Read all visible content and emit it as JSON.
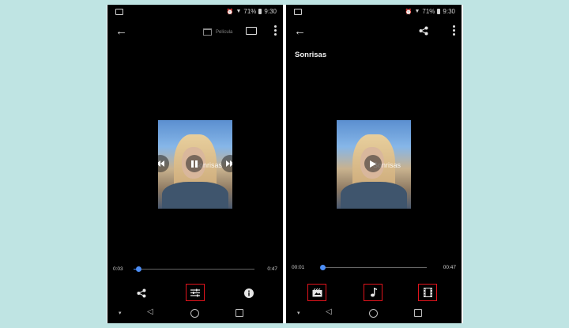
{
  "colors": {
    "background": "#bfe4e3",
    "highlight_box": "#e0141c",
    "progress": "#4c8ef7"
  },
  "left_screen": {
    "status": {
      "signal": "71%",
      "time": "9:30"
    },
    "toolbar": {
      "movie_label": "Película",
      "back_icon": "arrow-left-icon",
      "cast_icon": "cast-icon",
      "more_icon": "more-vert-icon"
    },
    "video": {
      "overlay_title": "Sonrisas",
      "state": "playing"
    },
    "progress": {
      "current": "0:03",
      "duration": "0:47",
      "fraction": 0.04
    },
    "actions": [
      {
        "icon": "share-icon",
        "highlighted": false
      },
      {
        "icon": "adjust-icon",
        "highlighted": true
      },
      {
        "icon": "info-icon",
        "highlighted": false
      }
    ]
  },
  "right_screen": {
    "status": {
      "signal": "71%",
      "time": "9:30"
    },
    "toolbar": {
      "back_icon": "arrow-left-icon",
      "share_icon": "share-icon",
      "more_icon": "more-vert-icon"
    },
    "title": "Sonrisas",
    "video": {
      "overlay_title": "Sonrisas",
      "state": "paused"
    },
    "progress": {
      "current": "00:01",
      "duration": "00:47",
      "fraction": 0.02
    },
    "actions": [
      {
        "icon": "theme-icon",
        "highlighted": true
      },
      {
        "icon": "music-icon",
        "highlighted": true
      },
      {
        "icon": "film-icon",
        "highlighted": true
      }
    ]
  }
}
